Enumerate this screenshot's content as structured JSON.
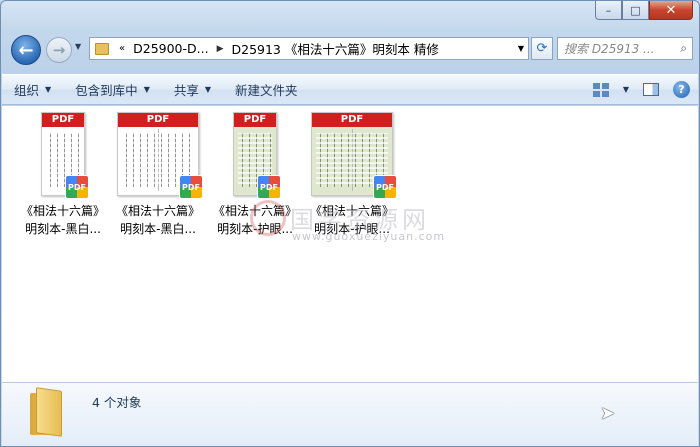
{
  "window": {
    "caption": {
      "minimize": "–",
      "maximize": "□",
      "close": "✕"
    }
  },
  "nav": {
    "back_glyph": "←",
    "forward_glyph": "→",
    "address": {
      "prefix": "«",
      "segments": [
        "D25900-D...",
        "D25913 《相法十六篇》明刻本 精修"
      ]
    },
    "refresh_glyph": "⟳",
    "search_placeholder": "搜索 D25913 ..."
  },
  "commandbar": {
    "items": [
      {
        "label": "组织",
        "has_dropdown": true
      },
      {
        "label": "包含到库中",
        "has_dropdown": true
      },
      {
        "label": "共享",
        "has_dropdown": true
      },
      {
        "label": "新建文件夹",
        "has_dropdown": false
      }
    ],
    "help_glyph": "?"
  },
  "files": [
    {
      "line1": "《相法十六篇》",
      "line2": "明刻本-黑白...",
      "badge": "PDF",
      "banner": "PDF",
      "style": "bw"
    },
    {
      "line1": "《相法十六篇》",
      "line2": "明刻本-黑白...",
      "badge": "PDF",
      "banner": "PDF",
      "style": "bw-wide"
    },
    {
      "line1": "《相法十六篇》",
      "line2": "明刻本-护眼...",
      "badge": "PDF",
      "banner": "PDF",
      "style": "green"
    },
    {
      "line1": "《相法十六篇》",
      "line2": "明刻本-护眼...",
      "badge": "PDF",
      "banner": "PDF",
      "style": "green-wide"
    }
  ],
  "watermark": {
    "text": "国学资源网",
    "url": "www.guoxueziyuan.com"
  },
  "details": {
    "count_text": "4 个对象"
  },
  "colors": {
    "accent": "#2a68b5",
    "pdf_banner": "#d11f1f"
  }
}
